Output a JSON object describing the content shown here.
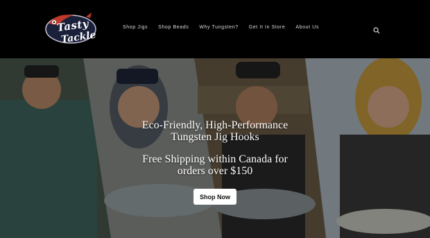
{
  "brand": {
    "line1": "Tasty",
    "line2": "Tackle"
  },
  "nav": {
    "items": [
      "Shop Jigs",
      "Shop Beads",
      "Why Tungsten?",
      "Get It In Store",
      "About Us"
    ]
  },
  "search": {
    "icon": "search-icon"
  },
  "hero": {
    "line1": "Eco-Friendly, High-Performance",
    "line2": "Tungsten Jig Hooks",
    "line3": "Free Shipping within Canada for",
    "line4": "orders over $150",
    "cta": "Shop Now"
  },
  "colors": {
    "header_bg": "#000000",
    "button_bg": "#ffffff",
    "text": "#ffffff"
  }
}
